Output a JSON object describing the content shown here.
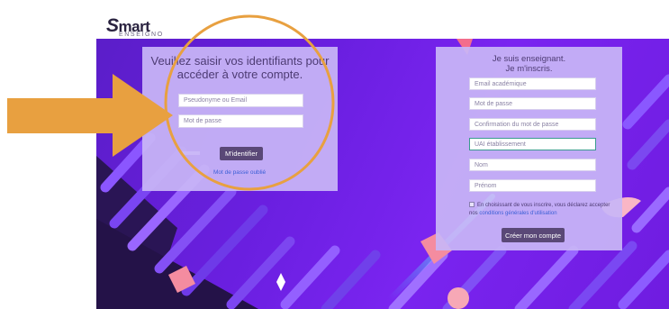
{
  "logo": {
    "word_first": "S",
    "word_rest": "mart",
    "sub": "ENSEIGNO"
  },
  "login": {
    "title": "Veuillez saisir vos identifiants pour accéder à votre compte.",
    "username_placeholder": "Pseudonyme ou Email",
    "password_placeholder": "Mot de passe",
    "submit_label": "M'identifier",
    "forgot_label": "Mot de passe oublié"
  },
  "register": {
    "title_line1": "Je suis enseignant.",
    "title_line2": "Je m'inscris.",
    "fields": [
      "Email académique",
      "Mot de passe",
      "Confirmation du mot de passe",
      "UAI établissement",
      "Nom",
      "Prénom"
    ],
    "terms_prefix": "En choisissant de vous inscrire, vous déclarez accepter nos ",
    "terms_link": "conditions générales d'utilisation",
    "submit_label": "Créer mon compte"
  },
  "colors": {
    "hero_purple": "#6a1fe0",
    "panel_lilac": "#c8b6f6",
    "button_dark": "#5a4877",
    "arrow_orange": "#e8a040",
    "link_blue": "#3b5fd6"
  },
  "annotations": {
    "arrow": "arrow-right-icon",
    "circle": "highlight-circle"
  }
}
